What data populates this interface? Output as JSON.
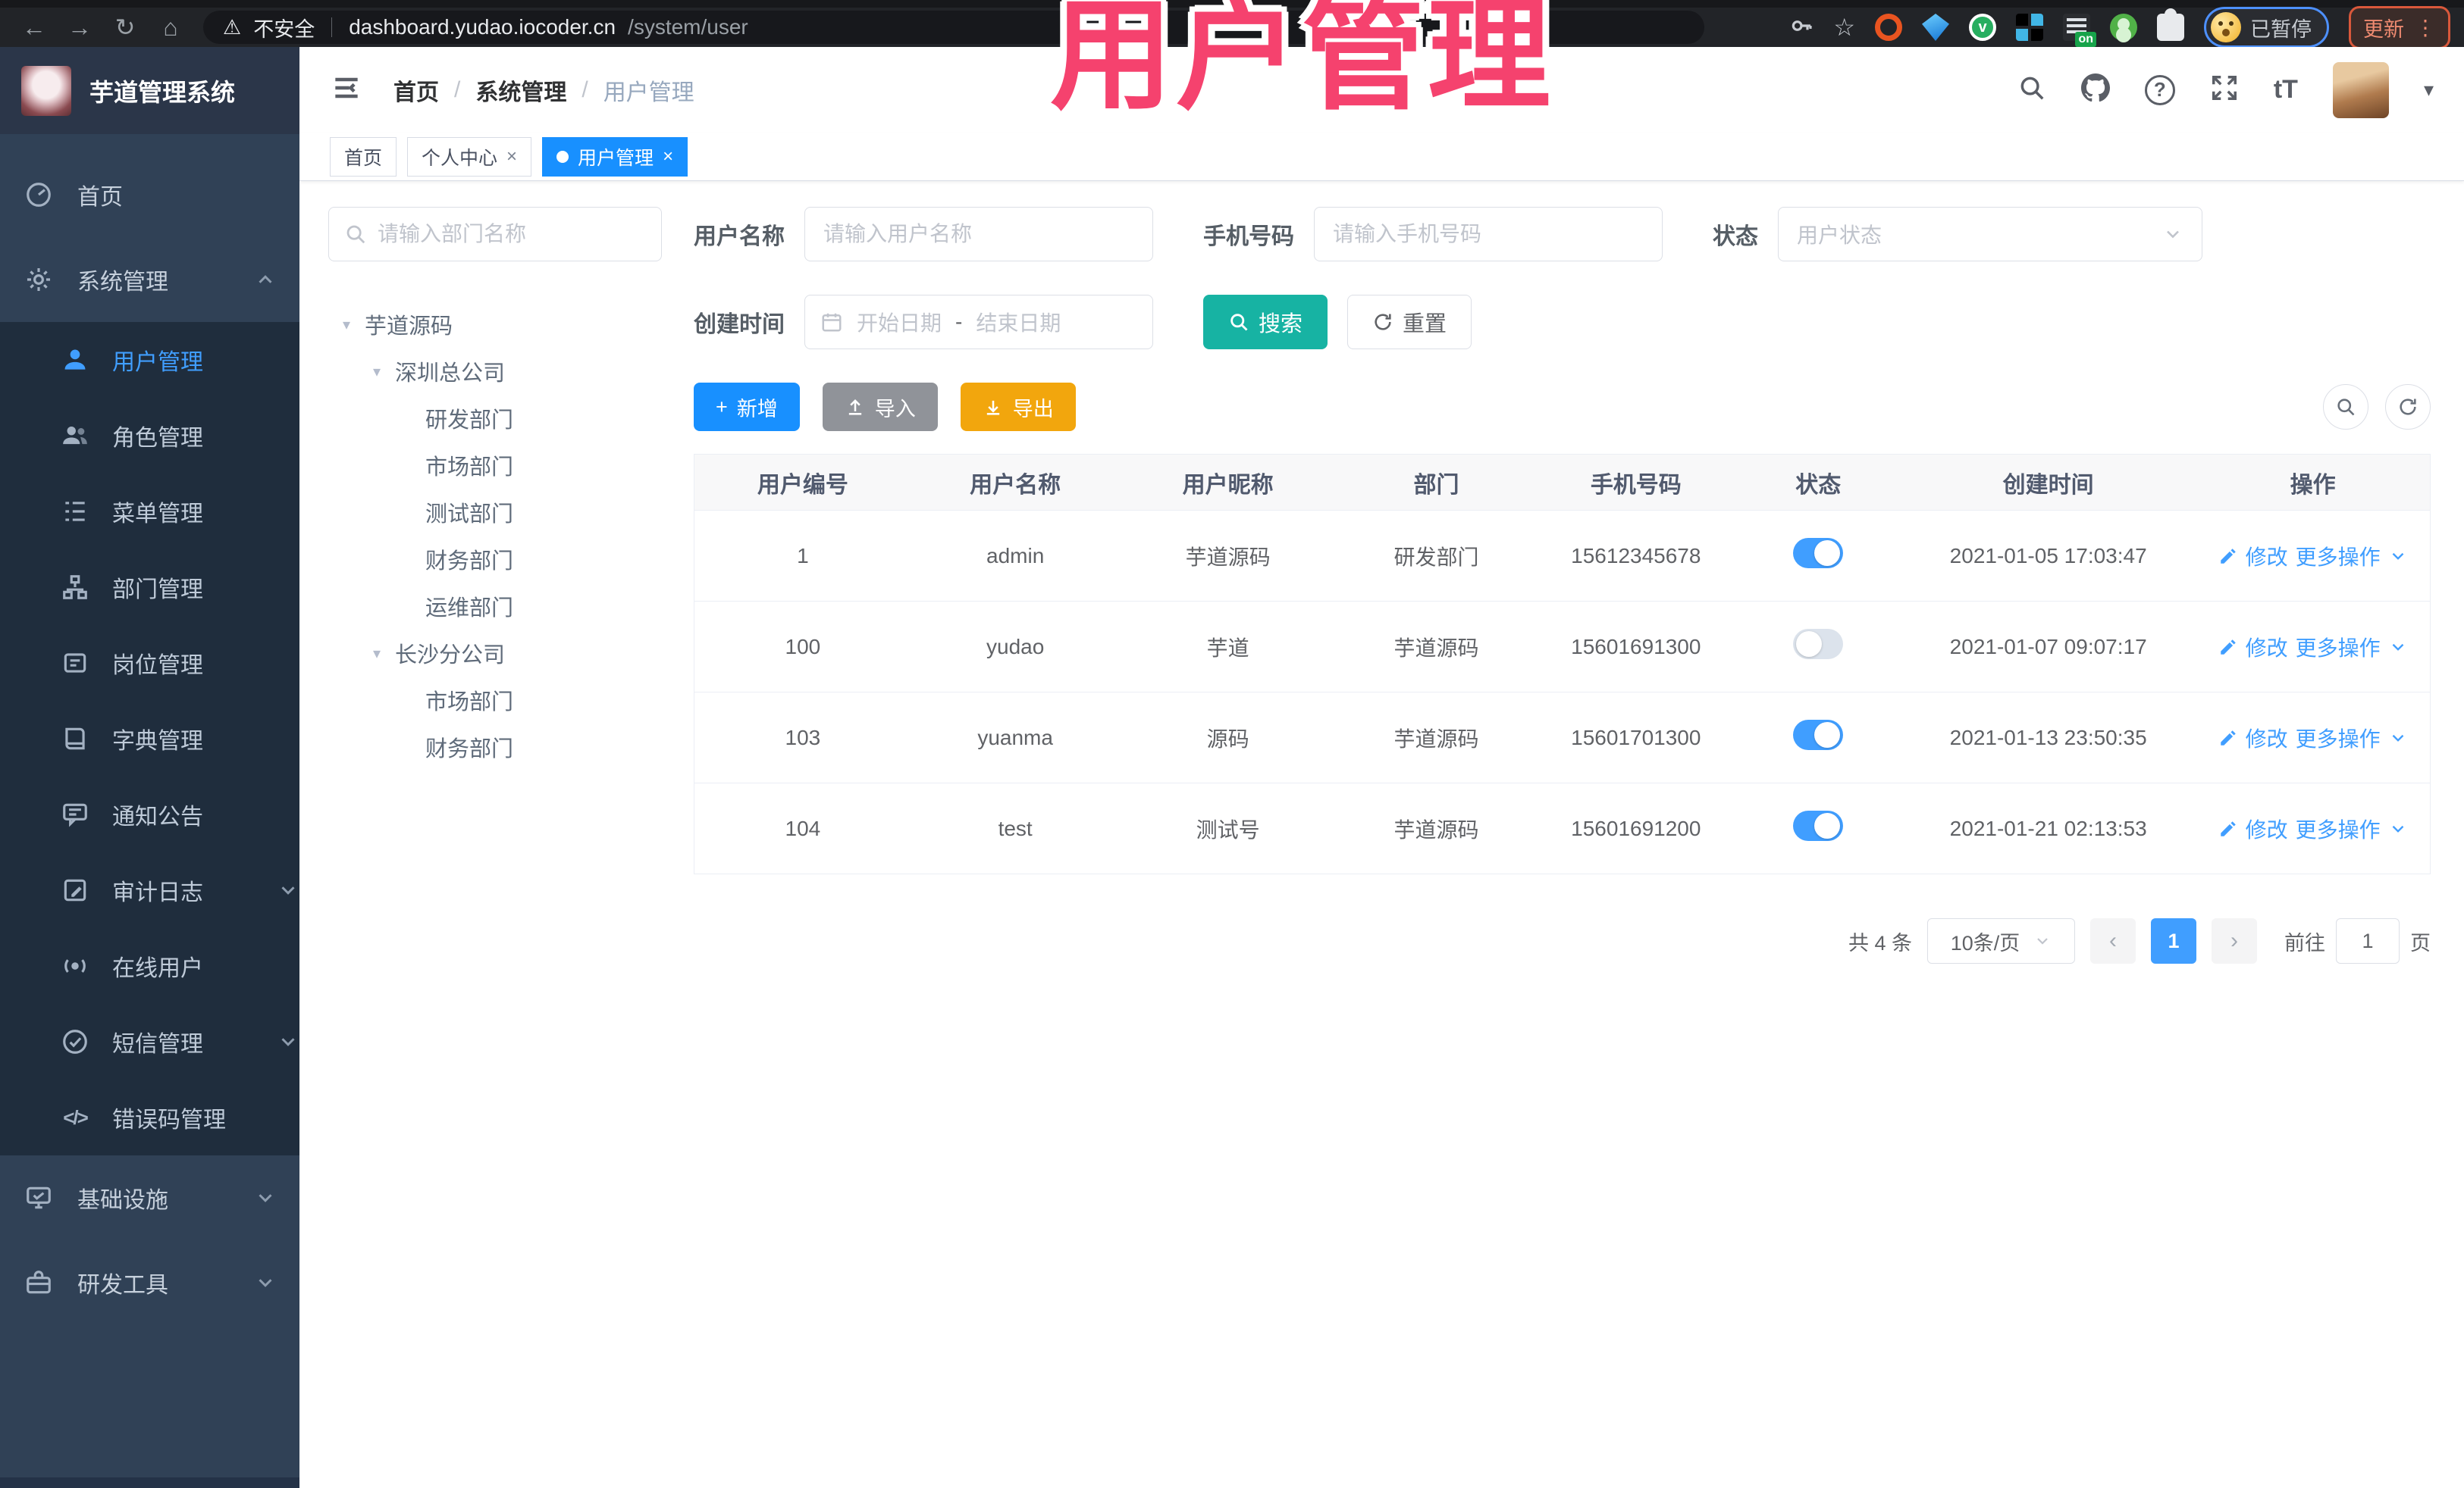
{
  "browser": {
    "back": "←",
    "forward": "→",
    "reload": "↻",
    "home": "⌂",
    "warning": "⚠",
    "security_label": "不安全",
    "url_host": "dashboard.yudao.iocoder.cn",
    "url_path": "/system/user",
    "star": "☆",
    "on_badge": "on",
    "profile_status": "已暂停",
    "update_label": "更新",
    "menu_dots": "⋮"
  },
  "overlay": {
    "title": "用户管理"
  },
  "header": {
    "logo_title": "芋道管理系统",
    "breadcrumb": {
      "sep": "/",
      "items": [
        "首页",
        "系统管理",
        "用户管理"
      ]
    },
    "help_glyph": "?",
    "font_glyph": "tT",
    "caret": "▾"
  },
  "tabs": [
    {
      "label": "首页"
    },
    {
      "label": "个人中心",
      "close": "×"
    },
    {
      "label": "用户管理",
      "close": "×"
    }
  ],
  "sidebar": {
    "home": "首页",
    "system": "系统管理",
    "sub": [
      "用户管理",
      "角色管理",
      "菜单管理",
      "部门管理",
      "岗位管理",
      "字典管理",
      "通知公告",
      "审计日志",
      "在线用户",
      "短信管理",
      "错误码管理"
    ],
    "infra": "基础设施",
    "devtool": "研发工具",
    "code_glyph": "</>"
  },
  "tree": {
    "search_placeholder": "请输入部门名称",
    "arrow": "▾",
    "nodes": [
      {
        "label": "芋道源码"
      },
      {
        "label": "深圳总公司"
      },
      {
        "label": "研发部门"
      },
      {
        "label": "市场部门"
      },
      {
        "label": "测试部门"
      },
      {
        "label": "财务部门"
      },
      {
        "label": "运维部门"
      },
      {
        "label": "长沙分公司"
      },
      {
        "label": "市场部门"
      },
      {
        "label": "财务部门"
      }
    ]
  },
  "filters": {
    "username_label": "用户名称",
    "username_placeholder": "请输入用户名称",
    "mobile_label": "手机号码",
    "mobile_placeholder": "请输入手机号码",
    "status_label": "状态",
    "status_placeholder": "用户状态",
    "time_label": "创建时间",
    "start_placeholder": "开始日期",
    "range_sep": "-",
    "end_placeholder": "结束日期",
    "search_label": "搜索",
    "reset_label": "重置"
  },
  "toolbar": {
    "add": "新增",
    "import": "导入",
    "export": "导出",
    "plus": "+"
  },
  "table": {
    "columns": [
      "用户编号",
      "用户名称",
      "用户昵称",
      "部门",
      "手机号码",
      "状态",
      "创建时间",
      "操作"
    ],
    "edit_label": "修改",
    "more_label": "更多操作",
    "rows": [
      {
        "id": "1",
        "username": "admin",
        "nickname": "芋道源码",
        "dept": "研发部门",
        "mobile": "15612345678",
        "status": "on",
        "created": "2021-01-05 17:03:47"
      },
      {
        "id": "100",
        "username": "yudao",
        "nickname": "芋道",
        "dept": "芋道源码",
        "mobile": "15601691300",
        "status": "off",
        "created": "2021-01-07 09:07:17"
      },
      {
        "id": "103",
        "username": "yuanma",
        "nickname": "源码",
        "dept": "芋道源码",
        "mobile": "15601701300",
        "status": "on",
        "created": "2021-01-13 23:50:35"
      },
      {
        "id": "104",
        "username": "test",
        "nickname": "测试号",
        "dept": "芋道源码",
        "mobile": "15601691200",
        "status": "on",
        "created": "2021-01-21 02:13:53"
      }
    ]
  },
  "pagination": {
    "total": "共 4 条",
    "page_size": "10条/页",
    "prev": "‹",
    "page": "1",
    "next": "›",
    "goto": "前往",
    "goto_value": "1",
    "unit": "页"
  }
}
